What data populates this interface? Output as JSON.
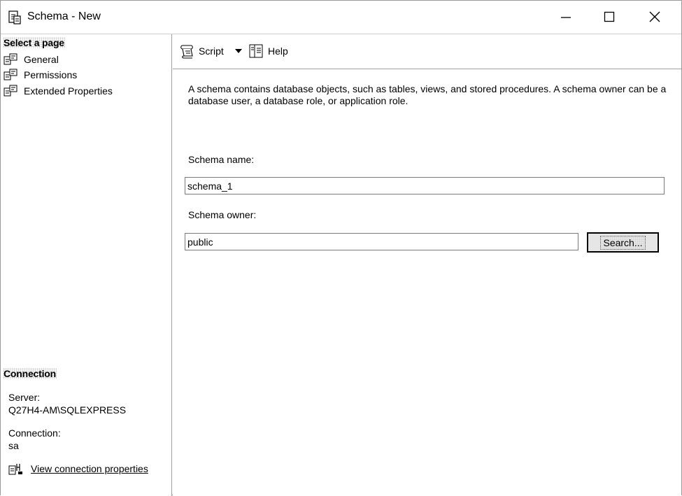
{
  "window": {
    "title": "Schema - New",
    "icon": "schema-icon",
    "controls": [
      "minimize-icon",
      "maximize-icon",
      "close-icon"
    ]
  },
  "sidebar": {
    "select_page_heading": "Select a page",
    "items": [
      {
        "label": "General",
        "icon": "page-icon"
      },
      {
        "label": "Permissions",
        "icon": "page-icon"
      },
      {
        "label": "Extended Properties",
        "icon": "page-icon"
      }
    ],
    "connection_heading": "Connection",
    "server_label": "Server:",
    "server_value": "Q27H4-AM\\SQLEXPRESS",
    "connection_label": "Connection:",
    "connection_value": "sa",
    "view_properties_link": "View connection properties"
  },
  "toolbar": {
    "script_label": "Script",
    "help_label": "Help"
  },
  "main": {
    "description": "A schema contains database objects, such as tables, views, and stored procedures. A schema owner can be a database user, a database role, or application role.",
    "schema_name_label": "Schema name:",
    "schema_name_value": "schema_1",
    "schema_owner_label": "Schema owner:",
    "schema_owner_value": "public",
    "search_button_label": "Search..."
  }
}
